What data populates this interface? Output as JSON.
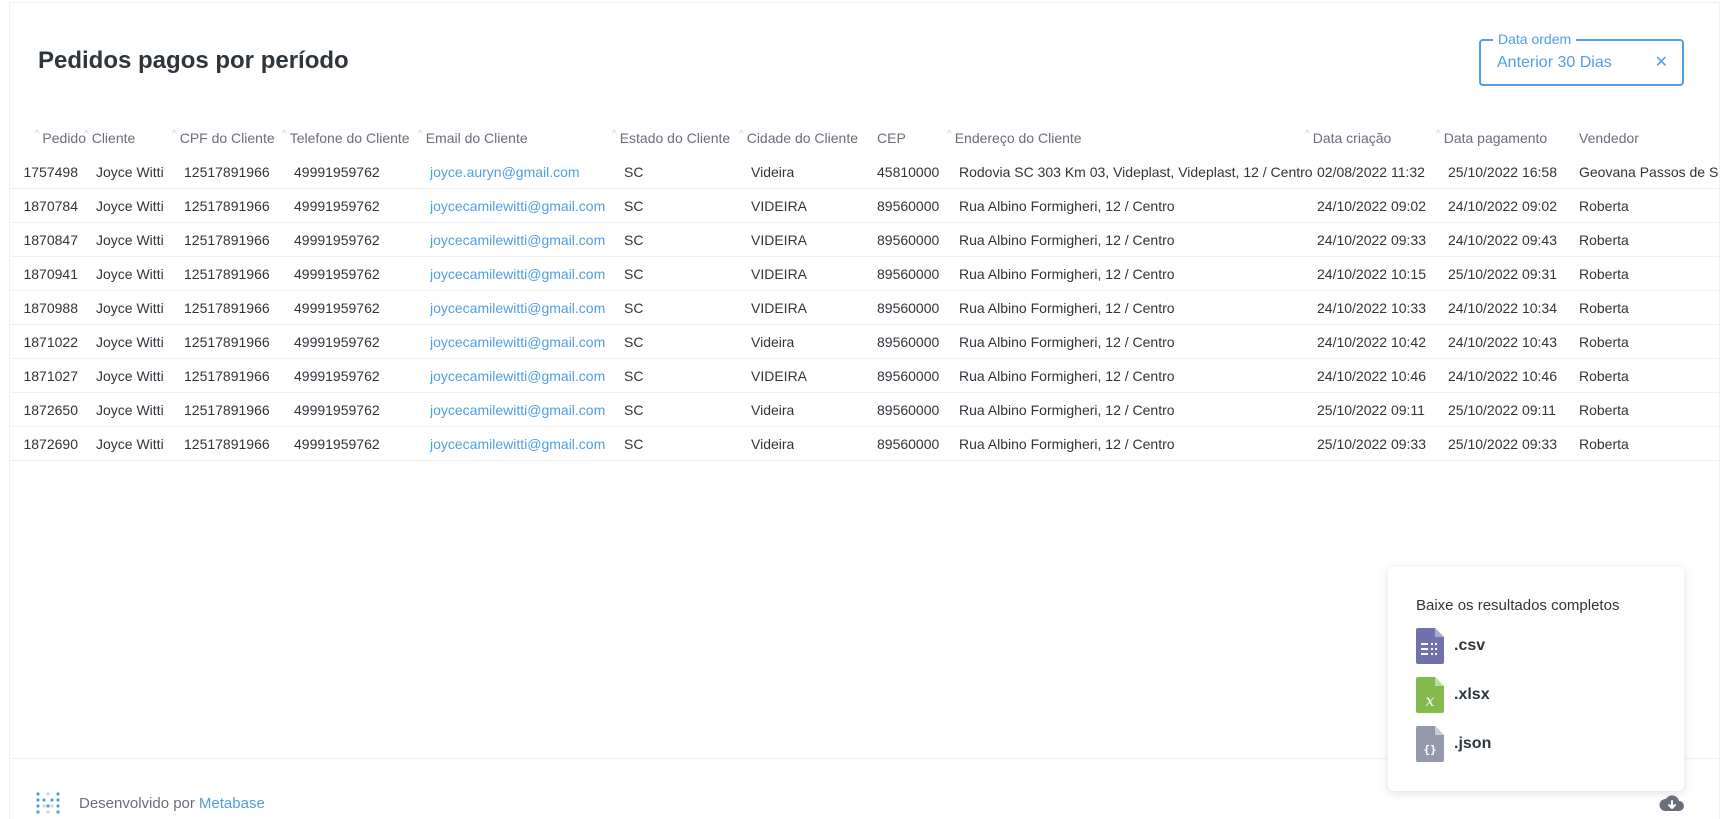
{
  "title": "Pedidos pagos por período",
  "filter": {
    "label": "Data ordem",
    "value": "Anterior 30 Dias",
    "clear_icon": "close-icon"
  },
  "columns": [
    "Pedido",
    "Cliente",
    "CPF do Cliente",
    "Telefone do Cliente",
    "Email do Cliente",
    "Estado do Cliente",
    "Cidade do Cliente",
    "CEP",
    "Endereço do Cliente",
    "Data criação",
    "Data pagamento",
    "Vendedor"
  ],
  "rows": [
    [
      "1757498",
      "Joyce Witti",
      "12517891966",
      "49991959762",
      "joyce.auryn@gmail.com",
      "SC",
      "Videira",
      "45810000",
      "Rodovia SC 303 Km 03, Videplast, Videplast, 12 / Centro",
      "02/08/2022 11:32",
      "25/10/2022 16:58",
      "Geovana Passos de Sou"
    ],
    [
      "1870784",
      "Joyce Witti",
      "12517891966",
      "49991959762",
      "joycecamilewitti@gmail.com",
      "SC",
      "VIDEIRA",
      "89560000",
      "Rua Albino Formigheri, 12 / Centro",
      "24/10/2022 09:02",
      "24/10/2022 09:02",
      "Roberta"
    ],
    [
      "1870847",
      "Joyce Witti",
      "12517891966",
      "49991959762",
      "joycecamilewitti@gmail.com",
      "SC",
      "VIDEIRA",
      "89560000",
      "Rua Albino Formigheri, 12 / Centro",
      "24/10/2022 09:33",
      "24/10/2022 09:43",
      "Roberta"
    ],
    [
      "1870941",
      "Joyce Witti",
      "12517891966",
      "49991959762",
      "joycecamilewitti@gmail.com",
      "SC",
      "VIDEIRA",
      "89560000",
      "Rua Albino Formigheri, 12 / Centro",
      "24/10/2022 10:15",
      "25/10/2022 09:31",
      "Roberta"
    ],
    [
      "1870988",
      "Joyce Witti",
      "12517891966",
      "49991959762",
      "joycecamilewitti@gmail.com",
      "SC",
      "VIDEIRA",
      "89560000",
      "Rua Albino Formigheri, 12 / Centro",
      "24/10/2022 10:33",
      "24/10/2022 10:34",
      "Roberta"
    ],
    [
      "1871022",
      "Joyce Witti",
      "12517891966",
      "49991959762",
      "joycecamilewitti@gmail.com",
      "SC",
      "Videira",
      "89560000",
      "Rua Albino Formigheri, 12 / Centro",
      "24/10/2022 10:42",
      "24/10/2022 10:43",
      "Roberta"
    ],
    [
      "1871027",
      "Joyce Witti",
      "12517891966",
      "49991959762",
      "joycecamilewitti@gmail.com",
      "SC",
      "VIDEIRA",
      "89560000",
      "Rua Albino Formigheri, 12 / Centro",
      "24/10/2022 10:46",
      "24/10/2022 10:46",
      "Roberta"
    ],
    [
      "1872650",
      "Joyce Witti",
      "12517891966",
      "49991959762",
      "joycecamilewitti@gmail.com",
      "SC",
      "Videira",
      "89560000",
      "Rua Albino Formigheri, 12 / Centro",
      "25/10/2022 09:11",
      "25/10/2022 09:11",
      "Roberta"
    ],
    [
      "1872690",
      "Joyce Witti",
      "12517891966",
      "49991959762",
      "joycecamilewitti@gmail.com",
      "SC",
      "Videira",
      "89560000",
      "Rua Albino Formigheri, 12 / Centro",
      "25/10/2022 09:33",
      "25/10/2022 09:33",
      "Roberta"
    ]
  ],
  "footer": {
    "prefix": "Desenvolvido por",
    "brand": "Metabase",
    "logo_icon": "metabase-logo-icon"
  },
  "download": {
    "title": "Baixe os resultados completos",
    "options": [
      {
        "ext": ".csv",
        "icon": "csv-file-icon",
        "color": "#7172ad"
      },
      {
        "ext": ".xlsx",
        "icon": "xlsx-file-icon",
        "color": "#84bb4c"
      },
      {
        "ext": ".json",
        "icon": "json-file-icon",
        "color": "#949aab"
      }
    ],
    "trigger_icon": "cloud-download-icon"
  },
  "colors": {
    "accent": "#509ee3",
    "text": "#2e353b",
    "muted": "#696e7b"
  }
}
